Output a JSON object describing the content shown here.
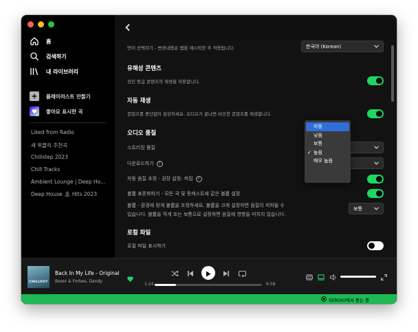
{
  "colors": {
    "accent_green": "#1ed760",
    "device_bar_green": "#1db954",
    "traffic_close": "#ff5f57",
    "traffic_min": "#febc2e",
    "traffic_max": "#28c840",
    "dropdown_highlight": "#2f6fd7"
  },
  "sidebar": {
    "nav": [
      {
        "label": "홈",
        "icon": "home-icon"
      },
      {
        "label": "검색하기",
        "icon": "search-icon"
      },
      {
        "label": "내 라이브러리",
        "icon": "library-icon"
      }
    ],
    "create_playlist": {
      "label": "플레이리스트 만들기",
      "icon": "plus-icon"
    },
    "liked_songs": {
      "label": "좋아요 표시한 곡",
      "icon": "heart-icon"
    },
    "playlists": [
      "Liked from Radio",
      "새 위클리 추천곡",
      "Chillstep 2023",
      "Chill Tracks",
      "Ambient Lounge | Deep Hou...",
      "Deep House 🏝 Hits 2023"
    ]
  },
  "settings": {
    "language": {
      "description": "언어 선택하기 - 변경내용은 앱을 재시작한 후 적용됩니다.",
      "value": "한국어 (Korean)"
    },
    "explicit": {
      "title": "유해성 콘텐츠",
      "description": "성인 등급 콘텐츠의 재생을 허용합니다.",
      "enabled": true
    },
    "autoplay": {
      "title": "자동 재생",
      "description": "콘텐츠를 중단없이 감상하세요. 오디오가 끝나면 비슷한 콘텐츠를 재생합니다.",
      "enabled": true
    },
    "audio_quality": {
      "title": "오디오 품질",
      "streaming_label": "스트리밍 품질",
      "download_label": "다운로드하기",
      "auto_adjust_label": "자동 음질 조정 - 권장 설정: 켜짐",
      "auto_adjust_enabled": true,
      "normalize_label": "볼륨 표준화하기 - 모든 곡 및 팟캐스트에 같은 볼륨 설정",
      "normalize_enabled": true,
      "volume_level_desc_1": "볼륨 - 환경에 맞게 볼륨을 조정하세요. 볼륨을 크게 설정하면 음질이 저하될 수",
      "volume_level_desc_2": "있습니다. 볼륨을 작게 또는 보통으로 설정하면 음질에 영향을 미치지 않습니다.",
      "volume_level_value": "보통"
    },
    "local_files": {
      "title": "로컬 파일",
      "show_label": "로컬 파일 표시하기",
      "enabled": false
    }
  },
  "dropdown": {
    "items": [
      "자동",
      "낮음",
      "보통",
      "높음",
      "매우 높음"
    ],
    "highlighted": "자동",
    "checked": "높음",
    "check_mark": "✓"
  },
  "player": {
    "track_title": "Back In My Life - Original Mix",
    "track_artist": "Boxer & Forbes, Dandy",
    "album_art_text": "CHILLOUT",
    "liked": true,
    "elapsed": "1:24",
    "duration": "6:58",
    "progress_fraction": 0.2,
    "volume_fraction": 1.0
  },
  "device_bar": {
    "text": "SERGIO에서 듣는 중"
  }
}
